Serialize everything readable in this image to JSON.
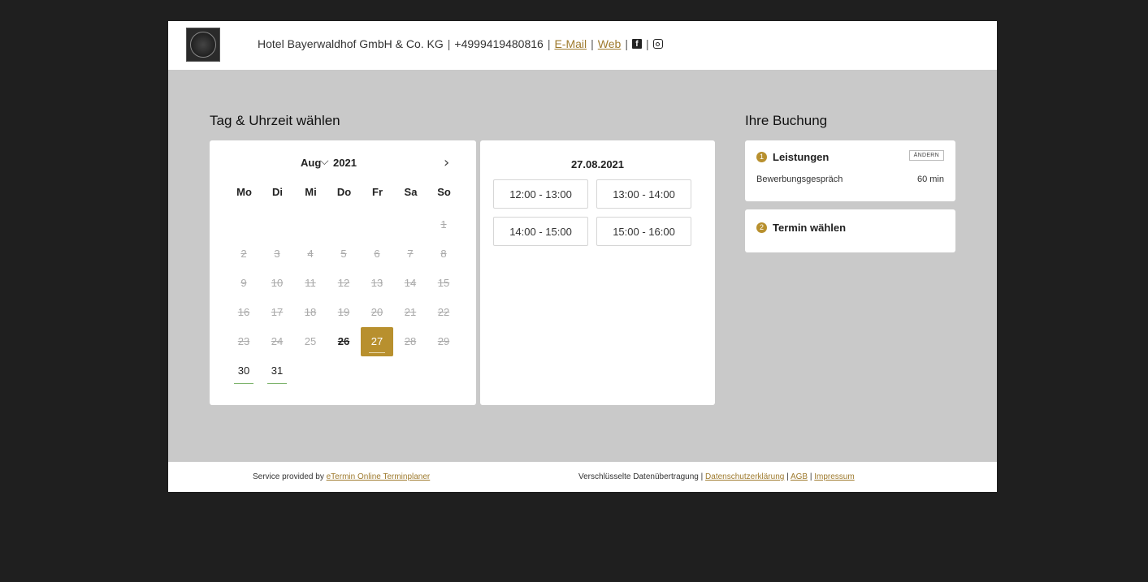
{
  "header": {
    "company": "Hotel Bayerwaldhof GmbH & Co. KG",
    "phone": "+4999419480816",
    "email_link": "E-Mail",
    "web_link": "Web",
    "separator": "|",
    "facebook_icon": "facebook-icon",
    "instagram_icon": "instagram-icon"
  },
  "datetime_section": {
    "title": "Tag & Uhrzeit wählen",
    "calendar": {
      "month": "Aug",
      "year": "2021",
      "next_icon": "chevron-right-icon",
      "month_dropdown_icon": "chevron-down-icon",
      "weekdays": [
        "Mo",
        "Di",
        "Mi",
        "Do",
        "Fr",
        "Sa",
        "So"
      ],
      "days": {
        "d1": "1",
        "d2": "2",
        "d3": "3",
        "d4": "4",
        "d5": "5",
        "d6": "6",
        "d7": "7",
        "d8": "8",
        "d9": "9",
        "d10": "10",
        "d11": "11",
        "d12": "12",
        "d13": "13",
        "d14": "14",
        "d15": "15",
        "d16": "16",
        "d17": "17",
        "d18": "18",
        "d19": "19",
        "d20": "20",
        "d21": "21",
        "d22": "22",
        "d23": "23",
        "d24": "24",
        "d25": "25",
        "d26": "26",
        "d27": "27",
        "d28": "28",
        "d29": "29",
        "d30": "30",
        "d31": "31"
      },
      "selected_day": "27",
      "accent_color": "#b8902e"
    },
    "slots": {
      "date": "27.08.2021",
      "times": [
        "12:00 - 13:00",
        "13:00 - 14:00",
        "14:00 - 15:00",
        "15:00 - 16:00"
      ]
    }
  },
  "booking": {
    "title": "Ihre Buchung",
    "step1": {
      "num": "1",
      "title": "Leistungen",
      "change_label": "ÄNDERN",
      "service": "Bewerbungsgespräch",
      "duration": "60 min"
    },
    "step2": {
      "num": "2",
      "title": "Termin wählen"
    }
  },
  "footer": {
    "provided_by": "Service provided by",
    "etermin_link": "eTermin Online Terminplaner",
    "encrypted": "Verschlüsselte Datenübertragung",
    "separator": "|",
    "privacy_link": "Datenschutzerklärung",
    "agb_link": "AGB",
    "impressum_link": "Impressum"
  }
}
